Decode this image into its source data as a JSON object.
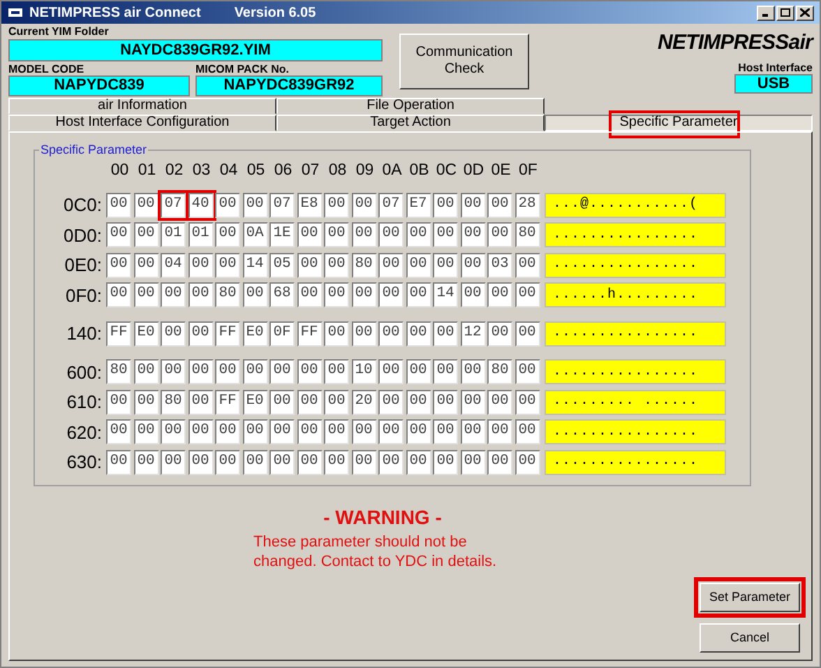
{
  "window": {
    "title": "NETIMPRESS air Connect",
    "version": "Version 6.05"
  },
  "header": {
    "yim_folder_label": "Current YIM Folder",
    "yim_folder": "NAYDC839GR92.YIM",
    "model_code_label": "MODEL CODE",
    "model_code": "NAPYDC839",
    "micom_pack_label": "MICOM PACK No.",
    "micom_pack": "NAPYDC839GR92",
    "comm_button": "Communication Check",
    "logo": "NETIMPRESS",
    "logo_suffix": "air",
    "host_interface_label": "Host Interface",
    "host_interface": "USB"
  },
  "tab_rows": [
    {
      "tabs": [
        {
          "label": "air Information",
          "selected": false,
          "highlighted": false
        },
        {
          "label": "File Operation",
          "selected": false,
          "highlighted": false
        }
      ]
    },
    {
      "tabs": [
        {
          "label": "Host Interface Configuration",
          "selected": false,
          "highlighted": false
        },
        {
          "label": "Target Action",
          "selected": false,
          "highlighted": false
        },
        {
          "label": "Specific Parameter",
          "selected": true,
          "highlighted": true
        }
      ]
    }
  ],
  "group": {
    "title": "Specific Parameter",
    "columns": [
      "00",
      "01",
      "02",
      "03",
      "04",
      "05",
      "06",
      "07",
      "08",
      "09",
      "0A",
      "0B",
      "0C",
      "0D",
      "0E",
      "0F"
    ],
    "blocks": [
      {
        "rows": [
          {
            "address": "0C0:",
            "ascii": "...@...........(",
            "cells": [
              {
                "v": "00",
                "hl": false
              },
              {
                "v": "00",
                "hl": false
              },
              {
                "v": "07",
                "hl": true
              },
              {
                "v": "40",
                "hl": true
              },
              {
                "v": "00",
                "hl": false
              },
              {
                "v": "00",
                "hl": false
              },
              {
                "v": "07",
                "hl": false
              },
              {
                "v": "E8",
                "hl": false
              },
              {
                "v": "00",
                "hl": false
              },
              {
                "v": "00",
                "hl": false
              },
              {
                "v": "07",
                "hl": false
              },
              {
                "v": "E7",
                "hl": false
              },
              {
                "v": "00",
                "hl": false
              },
              {
                "v": "00",
                "hl": false
              },
              {
                "v": "00",
                "hl": false
              },
              {
                "v": "28",
                "hl": false
              }
            ]
          },
          {
            "address": "0D0:",
            "ascii": "................",
            "cells": [
              {
                "v": "00",
                "hl": false
              },
              {
                "v": "00",
                "hl": false
              },
              {
                "v": "01",
                "hl": false
              },
              {
                "v": "01",
                "hl": false
              },
              {
                "v": "00",
                "hl": false
              },
              {
                "v": "0A",
                "hl": false
              },
              {
                "v": "1E",
                "hl": false
              },
              {
                "v": "00",
                "hl": false
              },
              {
                "v": "00",
                "hl": false
              },
              {
                "v": "00",
                "hl": false
              },
              {
                "v": "00",
                "hl": false
              },
              {
                "v": "00",
                "hl": false
              },
              {
                "v": "00",
                "hl": false
              },
              {
                "v": "00",
                "hl": false
              },
              {
                "v": "00",
                "hl": false
              },
              {
                "v": "80",
                "hl": false
              }
            ]
          },
          {
            "address": "0E0:",
            "ascii": "................",
            "cells": [
              {
                "v": "00",
                "hl": false
              },
              {
                "v": "00",
                "hl": false
              },
              {
                "v": "04",
                "hl": false
              },
              {
                "v": "00",
                "hl": false
              },
              {
                "v": "00",
                "hl": false
              },
              {
                "v": "14",
                "hl": false
              },
              {
                "v": "05",
                "hl": false
              },
              {
                "v": "00",
                "hl": false
              },
              {
                "v": "00",
                "hl": false
              },
              {
                "v": "80",
                "hl": false
              },
              {
                "v": "00",
                "hl": false
              },
              {
                "v": "00",
                "hl": false
              },
              {
                "v": "00",
                "hl": false
              },
              {
                "v": "00",
                "hl": false
              },
              {
                "v": "03",
                "hl": false
              },
              {
                "v": "00",
                "hl": false
              }
            ]
          },
          {
            "address": "0F0:",
            "ascii": "......h.........",
            "cells": [
              {
                "v": "00",
                "hl": false
              },
              {
                "v": "00",
                "hl": false
              },
              {
                "v": "00",
                "hl": false
              },
              {
                "v": "00",
                "hl": false
              },
              {
                "v": "80",
                "hl": false
              },
              {
                "v": "00",
                "hl": false
              },
              {
                "v": "68",
                "hl": false
              },
              {
                "v": "00",
                "hl": false
              },
              {
                "v": "00",
                "hl": false
              },
              {
                "v": "00",
                "hl": false
              },
              {
                "v": "00",
                "hl": false
              },
              {
                "v": "00",
                "hl": false
              },
              {
                "v": "14",
                "hl": false
              },
              {
                "v": "00",
                "hl": false
              },
              {
                "v": "00",
                "hl": false
              },
              {
                "v": "00",
                "hl": false
              }
            ]
          }
        ]
      },
      {
        "rows": [
          {
            "address": "140:",
            "ascii": "................",
            "cells": [
              {
                "v": "FF",
                "hl": false
              },
              {
                "v": "E0",
                "hl": false
              },
              {
                "v": "00",
                "hl": false
              },
              {
                "v": "00",
                "hl": false
              },
              {
                "v": "FF",
                "hl": false
              },
              {
                "v": "E0",
                "hl": false
              },
              {
                "v": "0F",
                "hl": false
              },
              {
                "v": "FF",
                "hl": false
              },
              {
                "v": "00",
                "hl": false
              },
              {
                "v": "00",
                "hl": false
              },
              {
                "v": "00",
                "hl": false
              },
              {
                "v": "00",
                "hl": false
              },
              {
                "v": "00",
                "hl": false
              },
              {
                "v": "12",
                "hl": false
              },
              {
                "v": "00",
                "hl": false
              },
              {
                "v": "00",
                "hl": false
              }
            ]
          }
        ]
      },
      {
        "rows": [
          {
            "address": "600:",
            "ascii": "................",
            "cells": [
              {
                "v": "80",
                "hl": false
              },
              {
                "v": "00",
                "hl": false
              },
              {
                "v": "00",
                "hl": false
              },
              {
                "v": "00",
                "hl": false
              },
              {
                "v": "00",
                "hl": false
              },
              {
                "v": "00",
                "hl": false
              },
              {
                "v": "00",
                "hl": false
              },
              {
                "v": "00",
                "hl": false
              },
              {
                "v": "00",
                "hl": false
              },
              {
                "v": "10",
                "hl": false
              },
              {
                "v": "00",
                "hl": false
              },
              {
                "v": "00",
                "hl": false
              },
              {
                "v": "00",
                "hl": false
              },
              {
                "v": "00",
                "hl": false
              },
              {
                "v": "80",
                "hl": false
              },
              {
                "v": "00",
                "hl": false
              }
            ]
          },
          {
            "address": "610:",
            "ascii": "......... ......",
            "cells": [
              {
                "v": "00",
                "hl": false
              },
              {
                "v": "00",
                "hl": false
              },
              {
                "v": "80",
                "hl": false
              },
              {
                "v": "00",
                "hl": false
              },
              {
                "v": "FF",
                "hl": false
              },
              {
                "v": "E0",
                "hl": false
              },
              {
                "v": "00",
                "hl": false
              },
              {
                "v": "00",
                "hl": false
              },
              {
                "v": "00",
                "hl": false
              },
              {
                "v": "20",
                "hl": false
              },
              {
                "v": "00",
                "hl": false
              },
              {
                "v": "00",
                "hl": false
              },
              {
                "v": "00",
                "hl": false
              },
              {
                "v": "00",
                "hl": false
              },
              {
                "v": "00",
                "hl": false
              },
              {
                "v": "00",
                "hl": false
              }
            ]
          },
          {
            "address": "620:",
            "ascii": "................",
            "cells": [
              {
                "v": "00",
                "hl": false
              },
              {
                "v": "00",
                "hl": false
              },
              {
                "v": "00",
                "hl": false
              },
              {
                "v": "00",
                "hl": false
              },
              {
                "v": "00",
                "hl": false
              },
              {
                "v": "00",
                "hl": false
              },
              {
                "v": "00",
                "hl": false
              },
              {
                "v": "00",
                "hl": false
              },
              {
                "v": "00",
                "hl": false
              },
              {
                "v": "00",
                "hl": false
              },
              {
                "v": "00",
                "hl": false
              },
              {
                "v": "00",
                "hl": false
              },
              {
                "v": "00",
                "hl": false
              },
              {
                "v": "00",
                "hl": false
              },
              {
                "v": "00",
                "hl": false
              },
              {
                "v": "00",
                "hl": false
              }
            ]
          },
          {
            "address": "630:",
            "ascii": "................",
            "cells": [
              {
                "v": "00",
                "hl": false
              },
              {
                "v": "00",
                "hl": false
              },
              {
                "v": "00",
                "hl": false
              },
              {
                "v": "00",
                "hl": false
              },
              {
                "v": "00",
                "hl": false
              },
              {
                "v": "00",
                "hl": false
              },
              {
                "v": "00",
                "hl": false
              },
              {
                "v": "00",
                "hl": false
              },
              {
                "v": "00",
                "hl": false
              },
              {
                "v": "00",
                "hl": false
              },
              {
                "v": "00",
                "hl": false
              },
              {
                "v": "00",
                "hl": false
              },
              {
                "v": "00",
                "hl": false
              },
              {
                "v": "00",
                "hl": false
              },
              {
                "v": "00",
                "hl": false
              },
              {
                "v": "00",
                "hl": false
              }
            ]
          }
        ]
      }
    ]
  },
  "warning": {
    "title": "- WARNING -",
    "message": "These parameter should not be changed. Contact to YDC in details."
  },
  "buttons": [
    {
      "label": "Set Parameter",
      "highlighted": true
    },
    {
      "label": "Cancel",
      "highlighted": false
    }
  ]
}
